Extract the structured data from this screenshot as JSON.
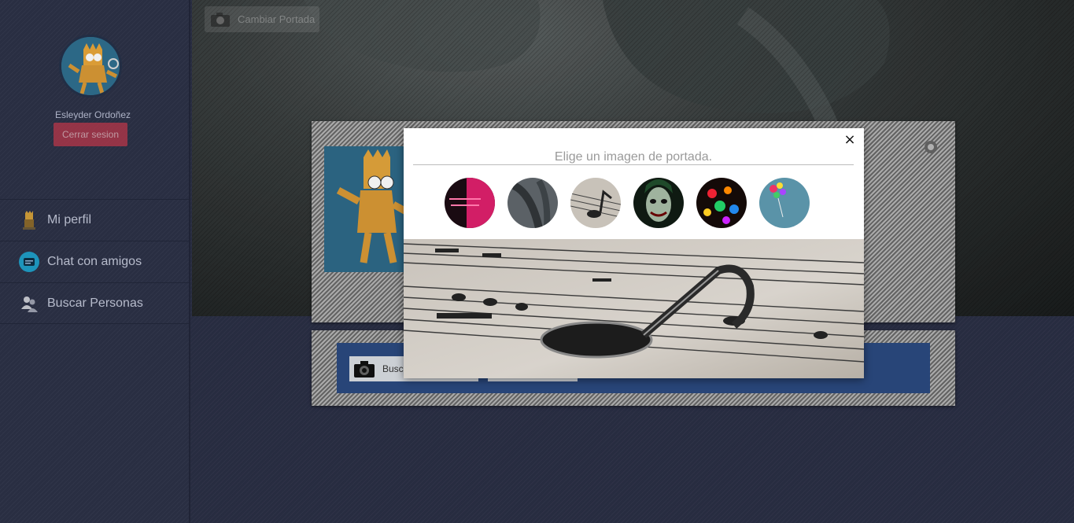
{
  "sidebar": {
    "user_name": "Esleyder Ordoñez",
    "logout_label": "Cerrar sesion",
    "items": [
      {
        "label": "Mi perfil",
        "icon": "bart-icon"
      },
      {
        "label": "Chat con amigos",
        "icon": "chat-icon"
      },
      {
        "label": "Buscar Personas",
        "icon": "people-search-icon"
      }
    ]
  },
  "cover": {
    "change_cover_label": "Cambiar Portada",
    "camera_icon": "camera-icon"
  },
  "profile_card": {
    "settings_icon": "gear-icon"
  },
  "search_card": {
    "search_label": "Busc"
  },
  "modal": {
    "title": "Elige un imagen de portada.",
    "close_label": "×",
    "thumbnails": [
      {
        "name": "pink-quote-thumbnail",
        "color": "#c21a5c"
      },
      {
        "name": "dark-headphones-thumbnail",
        "color": "#4a4f54"
      },
      {
        "name": "music-note-thumbnail",
        "color": "#bdb7ae"
      },
      {
        "name": "joker-thumbnail",
        "color": "#1a2a1c"
      },
      {
        "name": "colorful-lights-thumbnail",
        "color": "#7a2a1c"
      },
      {
        "name": "balloons-thumbnail",
        "color": "#4f8aa0"
      }
    ]
  },
  "colors": {
    "sidebar_bg": "#2c3147",
    "logout_red": "#b33a4d",
    "search_panel_blue": "#2b4a80"
  }
}
